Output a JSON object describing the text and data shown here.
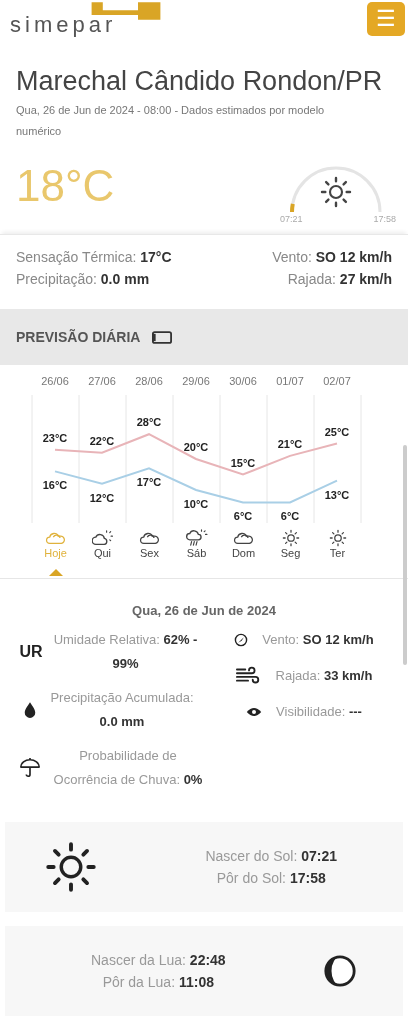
{
  "header": {
    "logo": "simepar",
    "menu_icon": "☰"
  },
  "location": {
    "title": "Marechal Cândido Rondon/PR",
    "subtitle": "Qua, 26 de Jun de 2024 - 08:00 - Dados estimados por modelo numérico"
  },
  "current": {
    "temperature": "18°C",
    "sun_arc": {
      "sunrise": "07:21",
      "sunset": "17:58"
    }
  },
  "summary": [
    {
      "label": "Sensação Térmica:",
      "value": "17°C"
    },
    {
      "label": "Vento:",
      "value": "SO 12 km/h"
    },
    {
      "label": "Precipitação:",
      "value": "0.0 mm"
    },
    {
      "label": "Rajada:",
      "value": "27 km/h"
    }
  ],
  "daily": {
    "title": "PREVISÃO DIÁRIA",
    "chart_data": {
      "type": "line",
      "categories": [
        "26/06",
        "27/06",
        "28/06",
        "29/06",
        "30/06",
        "01/07",
        "02/07"
      ],
      "data_labels": true,
      "series": [
        {
          "color": "#e8b4b8",
          "values": [
            23,
            22,
            28,
            20,
            15,
            21,
            25
          ],
          "value_labels": [
            "23°C",
            "22°C",
            "28°C",
            "20°C",
            "15°C",
            "21°C",
            "25°C"
          ]
        },
        {
          "color": "#a9cfe6",
          "values": [
            16,
            12,
            17,
            10,
            6,
            6,
            13
          ],
          "value_labels": [
            "16°C",
            "12°C",
            "17°C",
            "10°C",
            "6°C",
            "6°C",
            "13°C"
          ]
        }
      ]
    },
    "days": [
      {
        "label": "Hoje",
        "kind": "cloudy",
        "selected": true
      },
      {
        "label": "Qui",
        "kind": "partly-cloudy",
        "selected": false
      },
      {
        "label": "Sex",
        "kind": "cloudy",
        "selected": false
      },
      {
        "label": "Sáb",
        "kind": "rain",
        "selected": false
      },
      {
        "label": "Dom",
        "kind": "cloudy",
        "selected": false
      },
      {
        "label": "Seg",
        "kind": "sunny",
        "selected": false
      },
      {
        "label": "Ter",
        "kind": "sunny",
        "selected": false
      }
    ]
  },
  "detail": {
    "date": "Qua, 26 de Jun de 2024",
    "left": [
      {
        "kind": "humidity",
        "badge": "UR",
        "label": "Umidade Relativa:",
        "value": "62% - 99%"
      },
      {
        "kind": "precipitation",
        "label": "Precipitação Acumulada:",
        "value": "0.0 mm"
      },
      {
        "kind": "rain-chance",
        "label": "Probabilidade de Ocorrência de Chuva:",
        "value": "0%"
      }
    ],
    "right": [
      {
        "kind": "wind",
        "label": "Vento:",
        "value": "SO 12 km/h"
      },
      {
        "kind": "gust",
        "label": "Rajada:",
        "value": "33 km/h"
      },
      {
        "kind": "visibility",
        "label": "Visibilidade:",
        "value": "---"
      }
    ]
  },
  "sun": {
    "rise_label": "Nascer do Sol:",
    "rise": "07:21",
    "set_label": "Pôr do Sol:",
    "set": "17:58"
  },
  "moon": {
    "rise_label": "Nascer da Lua:",
    "rise": "22:48",
    "set_label": "Pôr da Lua:",
    "set": "11:08"
  }
}
